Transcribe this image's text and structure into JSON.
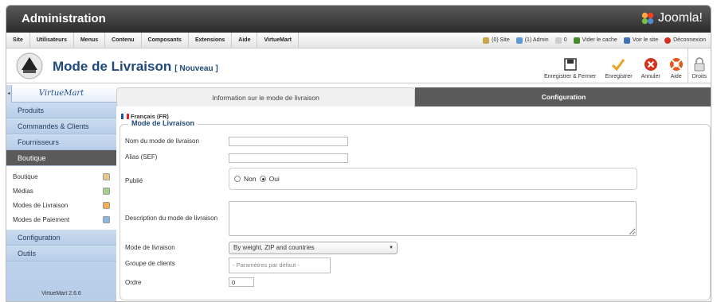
{
  "app": {
    "title": "Administration",
    "brand": "Joomla!"
  },
  "menu": [
    "Site",
    "Utilisateurs",
    "Menus",
    "Contenu",
    "Composants",
    "Extensions",
    "Aide",
    "VirtueMart"
  ],
  "status": {
    "site": "(0) Site",
    "admin": "(1) Admin",
    "count": "0",
    "clear_cache": "Vider le cache",
    "view_site": "Voir le site",
    "logout": "Déconnexion"
  },
  "page": {
    "title": "Mode de Livraison",
    "subtitle": "[ Nouveau ]"
  },
  "toolbar": {
    "save_close": "Enregistrer & Fermer",
    "save": "Enregistrer",
    "cancel": "Annuler",
    "help": "Aide",
    "rights": "Droits"
  },
  "sidebar": {
    "logo": "VirtueMart",
    "sections_top": [
      "Produits",
      "Commandes & Clients",
      "Fournisseurs",
      "Boutique"
    ],
    "sub_items": [
      "Boutique",
      "Médias",
      "Modes de Livraison",
      "Modes de Paiement"
    ],
    "sections_bottom": [
      "Configuration",
      "Outils"
    ],
    "version": "VirtueMart 2.6.6"
  },
  "tabs": {
    "info": "Information sur le mode de livraison",
    "config": "Configuration"
  },
  "form": {
    "language": "Français (FR)",
    "legend": "Mode de Livraison",
    "name_label": "Nom du mode de livraison",
    "name_value": "",
    "alias_label": "Alias (SEF)",
    "alias_value": "",
    "published_label": "Publié",
    "no": "Non",
    "yes": "Oui",
    "published": true,
    "description_label": "Description du mode de livraison",
    "method_label": "Mode de livraison",
    "method_value": "By weight, ZIP and countries",
    "groups_label": "Groupe de clients",
    "groups_placeholder": "- Paramètres par défaut -",
    "order_label": "Ordre",
    "order_value": "0"
  },
  "colors": {
    "accent": "#1f4a78",
    "topbar": "#3a3a3a",
    "sidebar": "#c5d8ee"
  }
}
